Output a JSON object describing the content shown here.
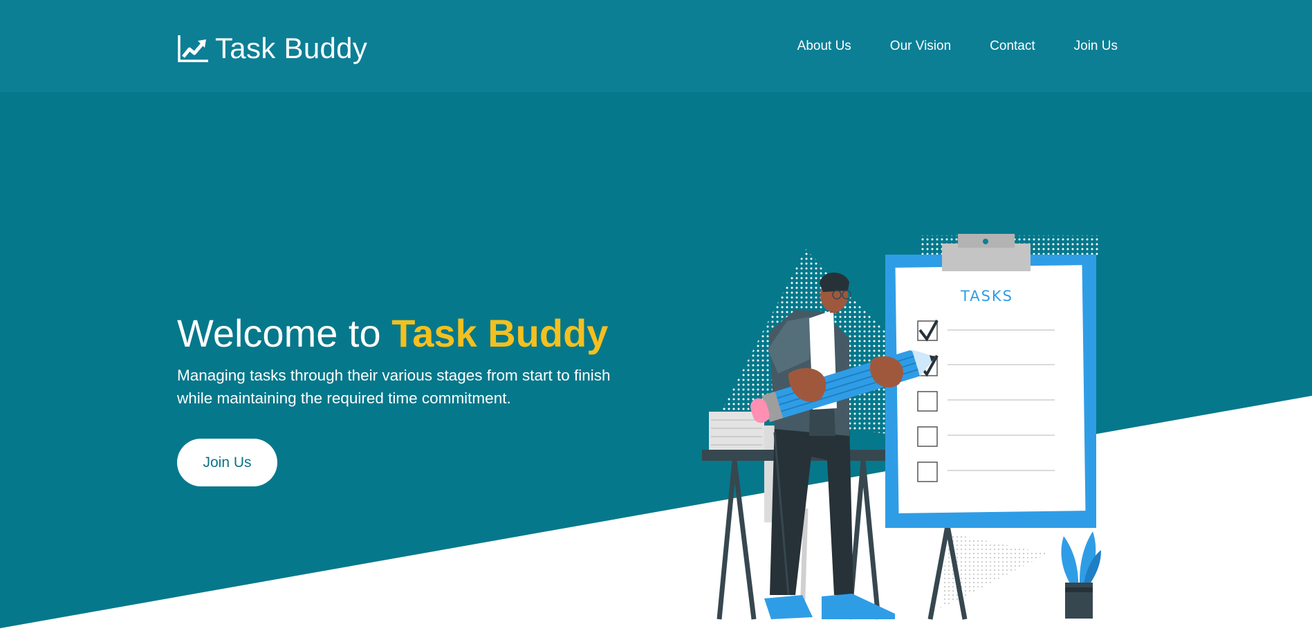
{
  "header": {
    "logo_text": "Task Buddy",
    "logo_icon": "chart-line-icon",
    "nav": [
      {
        "label": "About Us"
      },
      {
        "label": "Our Vision"
      },
      {
        "label": "Contact"
      },
      {
        "label": "Join Us"
      }
    ]
  },
  "hero": {
    "title_prefix": "Welcome to ",
    "title_highlight": "Task Buddy",
    "subtitle": "Managing tasks through their various stages from start to finish while maintaining the required time commitment.",
    "cta_label": "Join Us"
  },
  "illustration": {
    "board_title": "TASKS",
    "tasks": [
      {
        "checked": true
      },
      {
        "checked": true
      },
      {
        "checked": false
      },
      {
        "checked": false
      },
      {
        "checked": false
      }
    ]
  },
  "colors": {
    "header_bg": "#0c7f95",
    "hero_bg": "#06788b",
    "accent_yellow": "#f4c01e",
    "clipboard_blue": "#2f9de6",
    "button_text": "#0b7486"
  }
}
